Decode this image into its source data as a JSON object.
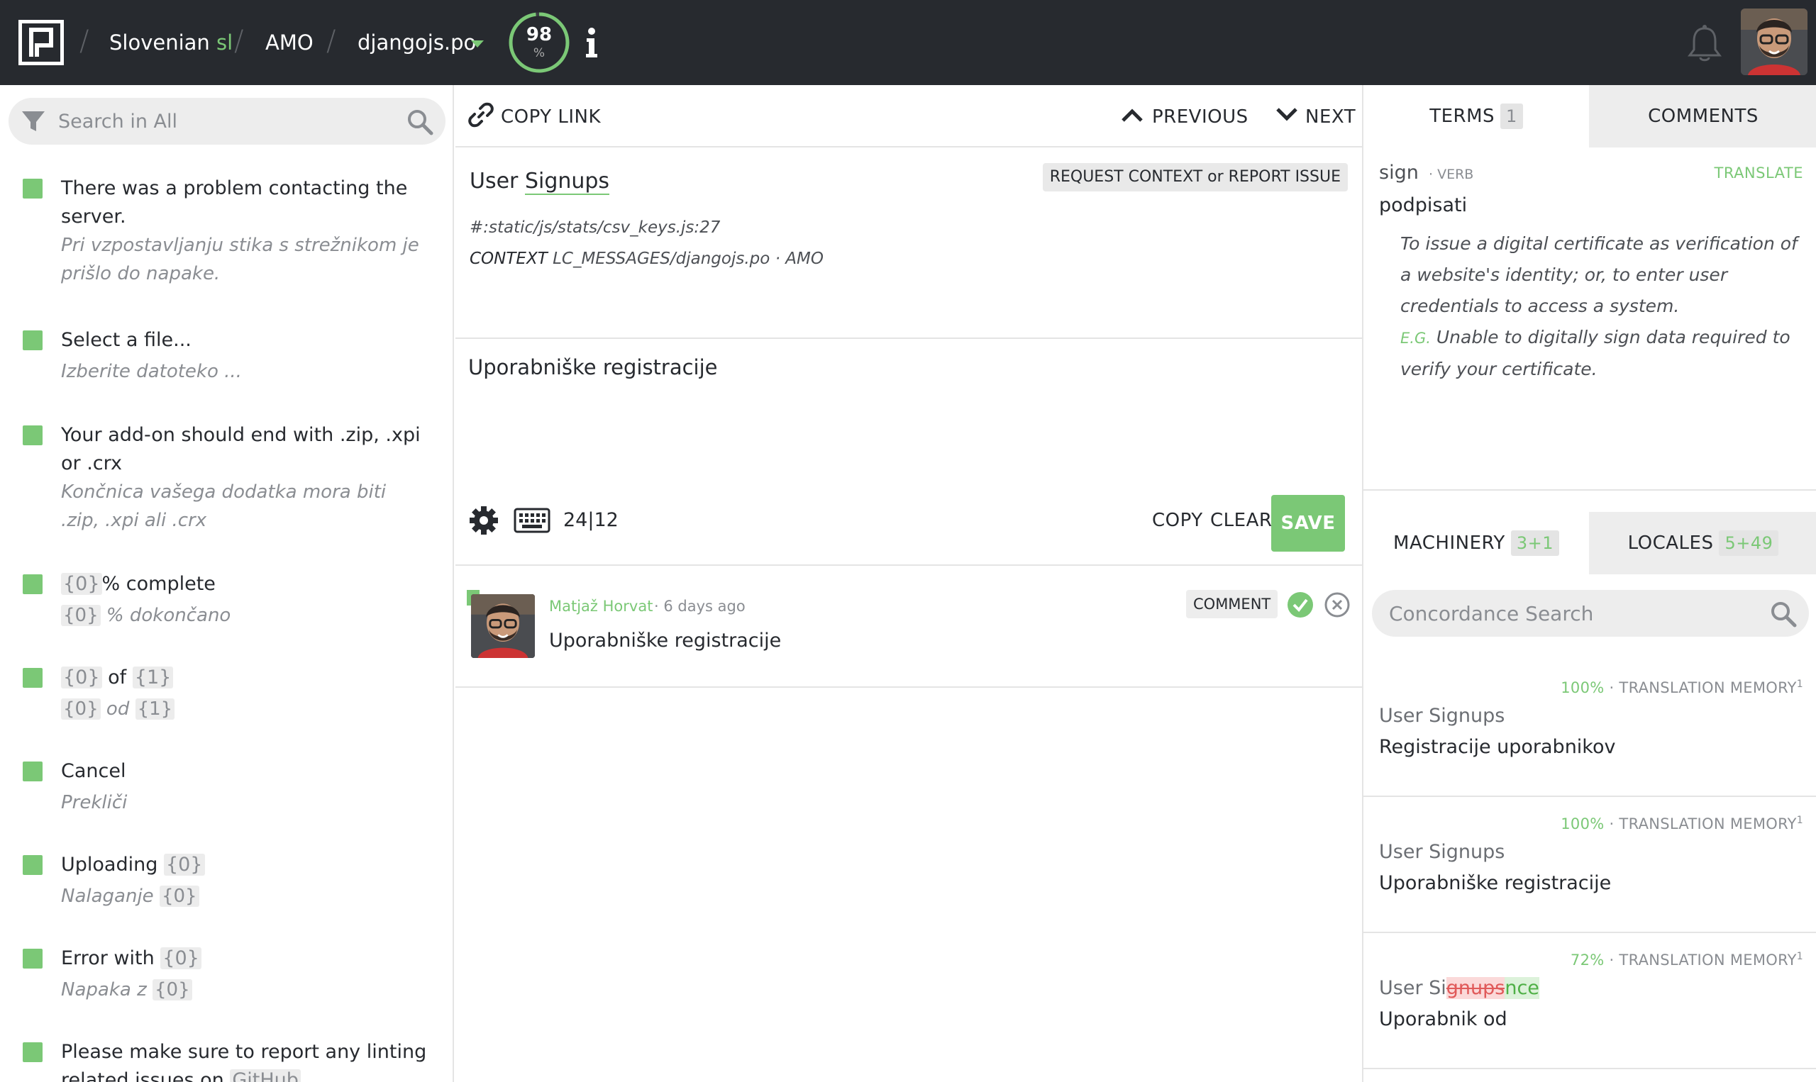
{
  "header": {
    "locale_name": "Slovenian",
    "locale_code": "sl",
    "project": "AMO",
    "resource": "djangojs.po",
    "progress_value": "98",
    "progress_unit": "%",
    "progress_fraction": 0.98
  },
  "sidebar": {
    "search_placeholder": "Search in All",
    "entities": [
      {
        "source": "There was a problem contacting the server.",
        "translation": "Pri vzpostavljanju stika s strežnikom je prišlo do napake."
      },
      {
        "source": "Select a file...",
        "translation": "Izberite datoteko ..."
      },
      {
        "source": "Your add-on should end with .zip, .xpi or .crx",
        "translation": "Končnica vašega dodatka mora biti .zip, .xpi ali .crx"
      },
      {
        "source_ph": "{0}",
        "source": "% complete",
        "translation_ph": "{0}",
        "translation": "% dokončano"
      },
      {
        "source_ph1": "{0}",
        "source_mid": "of",
        "source_ph2": "{1}",
        "translation_ph1": "{0}",
        "translation_mid": "od",
        "translation_ph2": "{1}"
      },
      {
        "source": "Cancel",
        "translation": "Prekliči"
      },
      {
        "source": "Uploading",
        "source_ph": "{0}",
        "translation": "Nalaganje",
        "translation_ph": "{0}"
      },
      {
        "source": "Error with",
        "source_ph": "{0}",
        "translation": "Napaka z",
        "translation_ph": "{0}"
      },
      {
        "source": "Please make sure to report any linting related issues on",
        "source_ph": "GitHub"
      }
    ]
  },
  "toolbar": {
    "copy_link": "COPY LINK",
    "previous": "PREVIOUS",
    "next": "NEXT"
  },
  "original": {
    "text_prefix": "User",
    "text_term": "Signups",
    "report_button": "REQUEST CONTEXT or REPORT ISSUE",
    "path": "#:static/js/stats/csv_keys.js:27",
    "context_label": "CONTEXT",
    "context_value": "LC_MESSAGES/djangojs.po · AMO"
  },
  "editor": {
    "value": "Uporabniške registracije",
    "counter": "24|12",
    "copy": "COPY",
    "clear": "CLEAR",
    "save": "SAVE"
  },
  "history": {
    "user": "Matjaž Horvat",
    "time": "· 6 days ago",
    "text": "Uporabniške registracije",
    "comment_button": "COMMENT"
  },
  "terms_tabs": {
    "terms": "TERMS",
    "terms_count": "1",
    "comments": "COMMENTS"
  },
  "term": {
    "source": "sign",
    "part_of_speech": "· VERB",
    "translate": "TRANSLATE",
    "translation": "podpisati",
    "definition": "To issue a digital certificate as verification of a website's identity; or, to enter user credentials to access a system.",
    "eg_label": "E.G.",
    "example": "Unable to digitally sign data required to verify your certificate."
  },
  "machinery_tabs": {
    "machinery": "MACHINERY",
    "machinery_count": "3+1",
    "locales": "LOCALES",
    "locales_count": "5+49"
  },
  "machinery": {
    "search_placeholder": "Concordance Search",
    "suggestions": [
      {
        "quality": "100%",
        "source_label": "· TRANSLATION MEMORY",
        "sup": "1",
        "original": "User Signups",
        "translation": "Registracije uporabnikov"
      },
      {
        "quality": "100%",
        "source_label": "· TRANSLATION MEMORY",
        "sup": "1",
        "original": "User Signups",
        "translation": "Uporabniške registracije"
      },
      {
        "quality": "72%",
        "source_label": "· TRANSLATION MEMORY",
        "sup": "1",
        "original_prefix": "User Si",
        "original_del": "gnups",
        "original_ins": "nce",
        "translation": "Uporabnik od"
      }
    ]
  },
  "colors": {
    "header_bg": "#272a2f",
    "accent_green": "#7bc876",
    "panel_gray": "#ededed"
  }
}
